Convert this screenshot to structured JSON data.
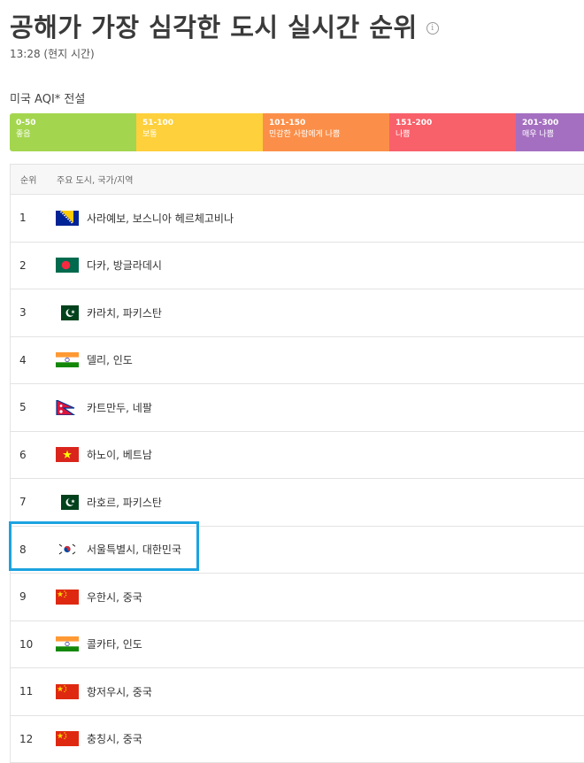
{
  "header": {
    "title": "공해가 가장 심각한 도시 실시간 순위",
    "info_icon": "info-icon",
    "time": "13:28 (현지 시간)"
  },
  "legend": {
    "title": "미국 AQI* 전설",
    "items": [
      {
        "range": "0-50",
        "label": "좋음",
        "color": "#a3d64e"
      },
      {
        "range": "51-100",
        "label": "보통",
        "color": "#fdd03c"
      },
      {
        "range": "101-150",
        "label": "민감한 사람에게 나쁨",
        "color": "#fb8f49"
      },
      {
        "range": "151-200",
        "label": "나쁨",
        "color": "#f8606a"
      },
      {
        "range": "201-300",
        "label": "매우 나쁨",
        "color": "#a46fc0"
      }
    ]
  },
  "table": {
    "headers": {
      "rank": "순위",
      "city": "주요 도시, 국가/지역"
    },
    "rows": [
      {
        "rank": "1",
        "city": "사라예보, 보스니아 헤르체고비나",
        "flag": "bosnia-flag-icon"
      },
      {
        "rank": "2",
        "city": "다카, 방글라데시",
        "flag": "bangladesh-flag-icon"
      },
      {
        "rank": "3",
        "city": "카라치, 파키스탄",
        "flag": "pakistan-flag-icon"
      },
      {
        "rank": "4",
        "city": "델리, 인도",
        "flag": "india-flag-icon"
      },
      {
        "rank": "5",
        "city": "카트만두, 네팔",
        "flag": "nepal-flag-icon"
      },
      {
        "rank": "6",
        "city": "하노이, 베트남",
        "flag": "vietnam-flag-icon"
      },
      {
        "rank": "7",
        "city": "라호르, 파키스탄",
        "flag": "pakistan-flag-icon"
      },
      {
        "rank": "8",
        "city": "서울특별시, 대한민국",
        "flag": "south-korea-flag-icon"
      },
      {
        "rank": "9",
        "city": "우한시, 중국",
        "flag": "china-flag-icon"
      },
      {
        "rank": "10",
        "city": "콜카타, 인도",
        "flag": "india-flag-icon"
      },
      {
        "rank": "11",
        "city": "항저우시, 중국",
        "flag": "china-flag-icon"
      },
      {
        "rank": "12",
        "city": "충칭시, 중국",
        "flag": "china-flag-icon"
      }
    ]
  },
  "highlight_color": "#1ca3e0"
}
